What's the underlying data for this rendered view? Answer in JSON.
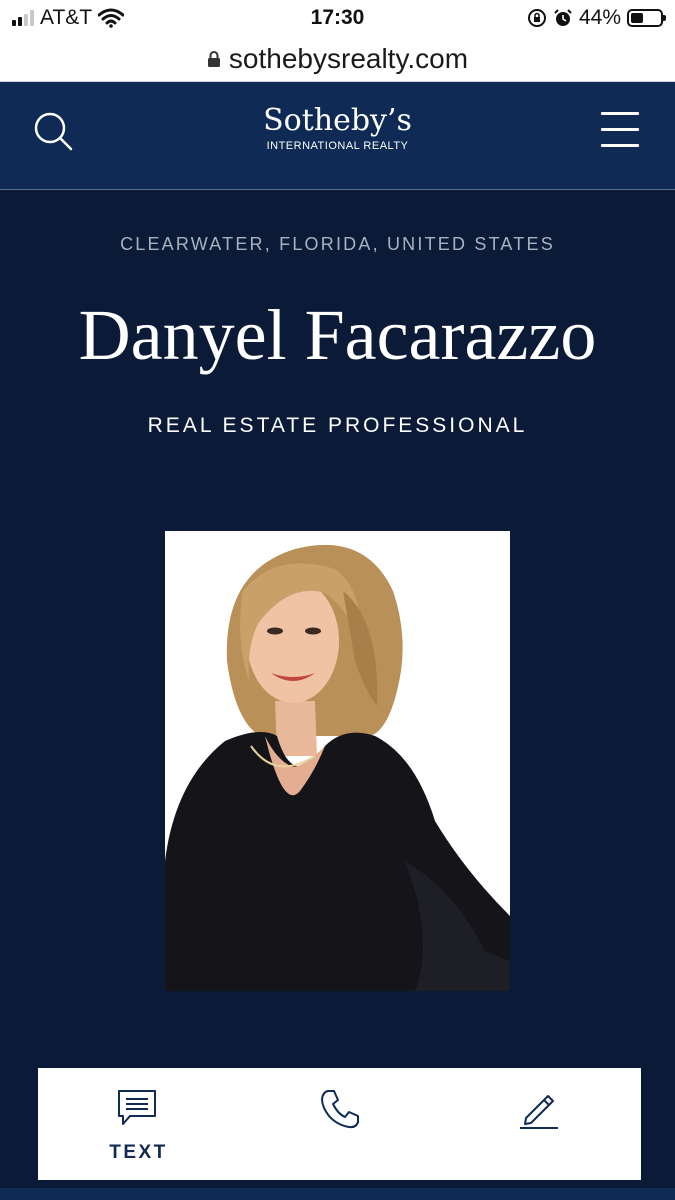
{
  "status_bar": {
    "carrier": "AT&T",
    "time": "17:30",
    "battery_percent": "44%",
    "battery_level": 0.44,
    "signal_bars": 2
  },
  "url_bar": {
    "url": "sothebysrealty.com",
    "icon": "lock-icon"
  },
  "header": {
    "logo_main": "Sotheby’s",
    "logo_sub": "INTERNATIONAL REALTY",
    "search_icon": "search-icon",
    "menu_icon": "hamburger-menu-icon"
  },
  "profile": {
    "location": "CLEARWATER, FLORIDA, UNITED STATES",
    "name": "Danyel Facarazzo",
    "role": "REAL ESTATE PROFESSIONAL"
  },
  "contact_bar": {
    "items": [
      {
        "label": "TEXT",
        "icon": "message-icon"
      },
      {
        "label": "",
        "icon": "phone-icon"
      },
      {
        "label": "",
        "icon": "pencil-icon"
      }
    ]
  },
  "colors": {
    "page_background": "#0b1a36",
    "header_background": "#0f2a54",
    "accent": "#0f2a54",
    "location_text": "#a9b1bf"
  }
}
